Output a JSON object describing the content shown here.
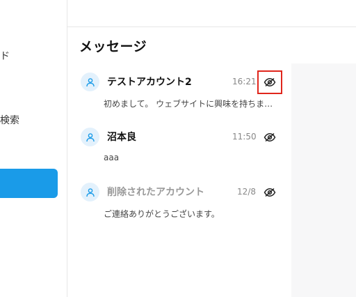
{
  "sidebar": {
    "glyph": "ド",
    "search_label": "検索"
  },
  "main": {
    "title": "メッセージ"
  },
  "messages": [
    {
      "name": "テストアカウント2",
      "time": "16:21",
      "preview": "初めまして。 ウェブサイトに興味を持ちま…",
      "deleted": false,
      "icon": "eye-off-icon"
    },
    {
      "name": "沼本良",
      "time": "11:50",
      "preview": "aaa",
      "deleted": false,
      "icon": "eye-off-icon"
    },
    {
      "name": "削除されたアカウント",
      "time": "12/8",
      "preview": "ご連絡ありがとうございます。",
      "deleted": true,
      "icon": "eye-off-icon"
    }
  ],
  "colors": {
    "accent": "#1a9be8",
    "highlight": "#e0261c",
    "avatar_bg": "#e3f1fc",
    "avatar_icon": "#1a9be8"
  }
}
